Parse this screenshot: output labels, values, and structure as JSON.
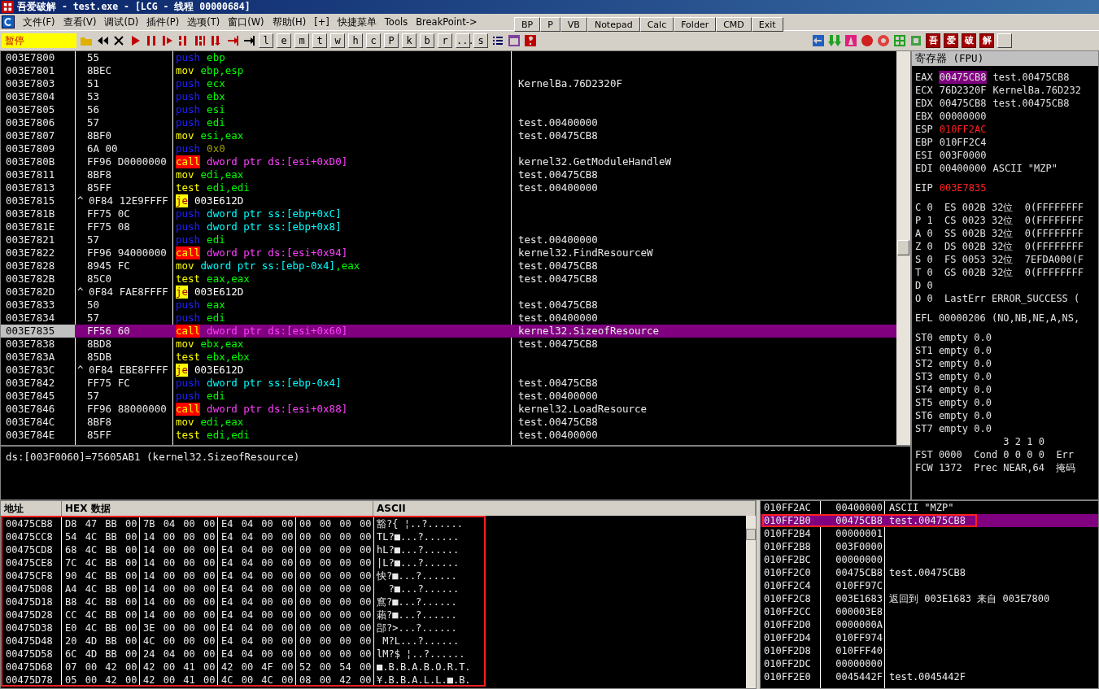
{
  "window": {
    "title": "吾爱破解 - test.exe - [LCG - 线程 00000684]"
  },
  "menu": [
    "文件(F)",
    "查看(V)",
    "调试(D)",
    "插件(P)",
    "选项(T)",
    "窗口(W)",
    "帮助(H)",
    "[+]",
    "快捷菜单",
    "Tools",
    "BreakPoint->"
  ],
  "quick_buttons": [
    "BP",
    "P",
    "VB",
    "Notepad",
    "Calc",
    "Folder",
    "CMD",
    "Exit"
  ],
  "toolbar": {
    "status": "暂停",
    "letters": [
      "l",
      "e",
      "m",
      "t",
      "w",
      "h",
      "c",
      "P",
      "k",
      "b",
      "r",
      "...",
      "s"
    ],
    "brand_buttons": [
      "吾",
      "爱",
      "破",
      "解"
    ]
  },
  "disassembly": {
    "rows": [
      {
        "address": "003E7800",
        "hex": "55",
        "mnemonic": "push",
        "kind": "push",
        "operands": [
          {
            "text": "ebp",
            "kind": "reg"
          }
        ],
        "selected": false
      },
      {
        "address": "003E7801",
        "hex": "8BEC",
        "mnemonic": "mov",
        "kind": "plain",
        "operands": [
          {
            "text": "ebp,esp",
            "kind": "reg"
          }
        ],
        "selected": false
      },
      {
        "address": "003E7803",
        "hex": "51",
        "mnemonic": "push",
        "kind": "push",
        "operands": [
          {
            "text": "ecx",
            "kind": "reg"
          }
        ],
        "comment": "KernelBa.76D2320F",
        "selected": false
      },
      {
        "address": "003E7804",
        "hex": "53",
        "mnemonic": "push",
        "kind": "push",
        "operands": [
          {
            "text": "ebx",
            "kind": "reg"
          }
        ],
        "selected": false
      },
      {
        "address": "003E7805",
        "hex": "56",
        "mnemonic": "push",
        "kind": "push",
        "operands": [
          {
            "text": "esi",
            "kind": "reg"
          }
        ],
        "selected": false
      },
      {
        "address": "003E7806",
        "hex": "57",
        "mnemonic": "push",
        "kind": "push",
        "operands": [
          {
            "text": "edi",
            "kind": "reg"
          }
        ],
        "comment": "test.00400000",
        "selected": false
      },
      {
        "address": "003E7807",
        "hex": "8BF0",
        "mnemonic": "mov",
        "kind": "plain",
        "operands": [
          {
            "text": "esi,eax",
            "kind": "reg"
          }
        ],
        "comment": "test.00475CB8",
        "selected": false
      },
      {
        "address": "003E7809",
        "hex": "6A 00",
        "mnemonic": "push",
        "kind": "push",
        "operands": [
          {
            "text": "0x0",
            "kind": "imm"
          }
        ],
        "selected": false
      },
      {
        "address": "003E780B",
        "hex": "FF96 D0000000",
        "mnemonic": "call",
        "kind": "call",
        "operands": [
          {
            "text": "dword ptr ds:[esi+0xD0]",
            "kind": "mem"
          }
        ],
        "comment": "kernel32.GetModuleHandleW",
        "selected": false
      },
      {
        "address": "003E7811",
        "hex": "8BF8",
        "mnemonic": "mov",
        "kind": "plain",
        "operands": [
          {
            "text": "edi,eax",
            "kind": "reg"
          }
        ],
        "comment": "test.00475CB8",
        "selected": false
      },
      {
        "address": "003E7813",
        "hex": "85FF",
        "mnemonic": "test",
        "kind": "plain",
        "operands": [
          {
            "text": "edi,edi",
            "kind": "reg"
          }
        ],
        "comment": "test.00400000",
        "selected": false
      },
      {
        "address": "003E7815",
        "jump_mark": "^",
        "hex": "0F84 12E9FFFF",
        "mnemonic": "je",
        "kind": "jump",
        "operands": [
          {
            "text": "003E612D",
            "kind": "addr"
          }
        ],
        "selected": false
      },
      {
        "address": "003E781B",
        "hex": "FF75 0C",
        "mnemonic": "push",
        "kind": "push",
        "operands": [
          {
            "text": "dword ptr ss:[ebp+0xC]",
            "kind": "stack"
          }
        ],
        "selected": false
      },
      {
        "address": "003E781E",
        "hex": "FF75 08",
        "mnemonic": "push",
        "kind": "push",
        "operands": [
          {
            "text": "dword ptr ss:[ebp+0x8]",
            "kind": "stack"
          }
        ],
        "selected": false
      },
      {
        "address": "003E7821",
        "hex": "57",
        "mnemonic": "push",
        "kind": "push",
        "operands": [
          {
            "text": "edi",
            "kind": "reg"
          }
        ],
        "comment": "test.00400000",
        "selected": false
      },
      {
        "address": "003E7822",
        "hex": "FF96 94000000",
        "mnemonic": "call",
        "kind": "call",
        "operands": [
          {
            "text": "dword ptr ds:[esi+0x94]",
            "kind": "mem"
          }
        ],
        "comment": "kernel32.FindResourceW",
        "selected": false
      },
      {
        "address": "003E7828",
        "hex": "8945 FC",
        "mnemonic": "mov",
        "kind": "plain",
        "operands": [
          {
            "text": "dword ptr ss:[ebp-0x4]",
            "kind": "stack"
          },
          {
            "text": ",eax",
            "kind": "reg"
          }
        ],
        "comment": "test.00475CB8",
        "selected": false
      },
      {
        "address": "003E782B",
        "hex": "85C0",
        "mnemonic": "test",
        "kind": "plain",
        "operands": [
          {
            "text": "eax,eax",
            "kind": "reg"
          }
        ],
        "comment": "test.00475CB8",
        "selected": false
      },
      {
        "address": "003E782D",
        "jump_mark": "^",
        "hex": "0F84 FAE8FFFF",
        "mnemonic": "je",
        "kind": "jump",
        "operands": [
          {
            "text": "003E612D",
            "kind": "addr"
          }
        ],
        "selected": false
      },
      {
        "address": "003E7833",
        "hex": "50",
        "mnemonic": "push",
        "kind": "push",
        "operands": [
          {
            "text": "eax",
            "kind": "reg"
          }
        ],
        "comment": "test.00475CB8",
        "selected": false
      },
      {
        "address": "003E7834",
        "hex": "57",
        "mnemonic": "push",
        "kind": "push",
        "operands": [
          {
            "text": "edi",
            "kind": "reg"
          }
        ],
        "comment": "test.00400000",
        "selected": false
      },
      {
        "address": "003E7835",
        "hex": "FF56 60",
        "mnemonic": "call",
        "kind": "call",
        "operands": [
          {
            "text": "dword ptr ds:[esi+0x60]",
            "kind": "mem"
          }
        ],
        "comment": "kernel32.SizeofResource",
        "selected": true
      },
      {
        "address": "003E7838",
        "hex": "8BD8",
        "mnemonic": "mov",
        "kind": "plain",
        "operands": [
          {
            "text": "ebx,eax",
            "kind": "reg"
          }
        ],
        "comment": "test.00475CB8",
        "selected": false
      },
      {
        "address": "003E783A",
        "hex": "85DB",
        "mnemonic": "test",
        "kind": "plain",
        "operands": [
          {
            "text": "ebx,ebx",
            "kind": "reg"
          }
        ],
        "selected": false
      },
      {
        "address": "003E783C",
        "jump_mark": "^",
        "hex": "0F84 EBE8FFFF",
        "mnemonic": "je",
        "kind": "jump",
        "operands": [
          {
            "text": "003E612D",
            "kind": "addr"
          }
        ],
        "selected": false
      },
      {
        "address": "003E7842",
        "hex": "FF75 FC",
        "mnemonic": "push",
        "kind": "push",
        "operands": [
          {
            "text": "dword ptr ss:[ebp-0x4]",
            "kind": "stack"
          }
        ],
        "comment": "test.00475CB8",
        "selected": false
      },
      {
        "address": "003E7845",
        "hex": "57",
        "mnemonic": "push",
        "kind": "push",
        "operands": [
          {
            "text": "edi",
            "kind": "reg"
          }
        ],
        "comment": "test.00400000",
        "selected": false
      },
      {
        "address": "003E7846",
        "hex": "FF96 88000000",
        "mnemonic": "call",
        "kind": "call",
        "operands": [
          {
            "text": "dword ptr ds:[esi+0x88]",
            "kind": "mem"
          }
        ],
        "comment": "kernel32.LoadResource",
        "selected": false
      },
      {
        "address": "003E784C",
        "hex": "8BF8",
        "mnemonic": "mov",
        "kind": "plain",
        "operands": [
          {
            "text": "edi,eax",
            "kind": "reg"
          }
        ],
        "comment": "test.00475CB8",
        "selected": false
      },
      {
        "address": "003E784E",
        "hex": "85FF",
        "mnemonic": "test",
        "kind": "plain",
        "operands": [
          {
            "text": "edi,edi",
            "kind": "reg"
          }
        ],
        "comment": "test.00400000",
        "selected": false
      }
    ],
    "info": "ds:[003F0060]=75605AB1 (kernel32.SizeofResource)"
  },
  "registers": {
    "title": "寄存器 (FPU)",
    "groups": [
      [
        {
          "kind": "reg",
          "name": "EAX",
          "value": "00475CB8",
          "comment": "test.00475CB8",
          "changed": false,
          "selected": true
        },
        {
          "kind": "reg",
          "name": "ECX",
          "value": "76D2320F",
          "comment": "KernelBa.76D232",
          "changed": false,
          "selected": false
        },
        {
          "kind": "reg",
          "name": "EDX",
          "value": "00475CB8",
          "comment": "test.00475CB8",
          "changed": false,
          "selected": false
        },
        {
          "kind": "reg",
          "name": "EBX",
          "value": "00000000",
          "changed": false,
          "selected": false
        },
        {
          "kind": "reg",
          "name": "ESP",
          "value": "010FF2AC",
          "changed": true,
          "selected": false
        },
        {
          "kind": "reg",
          "name": "EBP",
          "value": "010FF2C4",
          "changed": false,
          "selected": false
        },
        {
          "kind": "reg",
          "name": "ESI",
          "value": "003F0000",
          "changed": false,
          "selected": false
        },
        {
          "kind": "reg",
          "name": "EDI",
          "value": "00400000",
          "comment": "ASCII \"MZP\"",
          "changed": false,
          "selected": false
        }
      ],
      [
        {
          "kind": "reg",
          "name": "EIP",
          "value": "003E7835",
          "changed": true,
          "selected": false
        }
      ],
      [
        {
          "kind": "text",
          "text": "C 0  ES 002B 32位  0(FFFFFFFF"
        },
        {
          "kind": "text",
          "text": "P 1  CS 0023 32位  0(FFFFFFFF"
        },
        {
          "kind": "text",
          "text": "A 0  SS 002B 32位  0(FFFFFFFF"
        },
        {
          "kind": "text",
          "text": "Z 0  DS 002B 32位  0(FFFFFFFF"
        },
        {
          "kind": "text",
          "text": "S 0  FS 0053 32位  7EFDA000(F"
        },
        {
          "kind": "text",
          "text": "T 0  GS 002B 32位  0(FFFFFFFF"
        },
        {
          "kind": "text",
          "text": "D 0"
        },
        {
          "kind": "text",
          "text": "O 0  LastErr ERROR_SUCCESS ("
        }
      ],
      [
        {
          "kind": "text",
          "text": "EFL 00000206 (NO,NB,NE,A,NS,"
        }
      ],
      [
        {
          "kind": "text",
          "text": "ST0 empty 0.0"
        },
        {
          "kind": "text",
          "text": "ST1 empty 0.0"
        },
        {
          "kind": "text",
          "text": "ST2 empty 0.0"
        },
        {
          "kind": "text",
          "text": "ST3 empty 0.0"
        },
        {
          "kind": "text",
          "text": "ST4 empty 0.0"
        },
        {
          "kind": "text",
          "text": "ST5 empty 0.0"
        },
        {
          "kind": "text",
          "text": "ST6 empty 0.0"
        },
        {
          "kind": "text",
          "text": "ST7 empty 0.0"
        },
        {
          "kind": "text",
          "text": "               3 2 1 0"
        },
        {
          "kind": "text",
          "text": "FST 0000  Cond 0 0 0 0  Err"
        },
        {
          "kind": "text",
          "text": "FCW 1372  Prec NEAR,64  掩码"
        }
      ]
    ]
  },
  "dump": {
    "columns": [
      "地址",
      "HEX 数据",
      "ASCII"
    ],
    "annotated": true,
    "rows": [
      {
        "address": "00475CB8",
        "hex": [
          "D8 47 BB 00",
          "7B 04 00 00",
          "E4 04 00 00",
          "00 00 00 00"
        ],
        "ascii": "豁?{ ¦..?......"
      },
      {
        "address": "00475CC8",
        "hex": [
          "54 4C BB 00",
          "14 00 00 00",
          "E4 04 00 00",
          "00 00 00 00"
        ],
        "ascii": "TL?■...?......"
      },
      {
        "address": "00475CD8",
        "hex": [
          "68 4C BB 00",
          "14 00 00 00",
          "E4 04 00 00",
          "00 00 00 00"
        ],
        "ascii": "hL?■...?......"
      },
      {
        "address": "00475CE8",
        "hex": [
          "7C 4C BB 00",
          "14 00 00 00",
          "E4 04 00 00",
          "00 00 00 00"
        ],
        "ascii": "|L?■...?......"
      },
      {
        "address": "00475CF8",
        "hex": [
          "90 4C BB 00",
          "14 00 00 00",
          "E4 04 00 00",
          "00 00 00 00"
        ],
        "ascii": "怏?■...?......"
      },
      {
        "address": "00475D08",
        "hex": [
          "A4 4C BB 00",
          "14 00 00 00",
          "E4 04 00 00",
          "00 00 00 00"
        ],
        "ascii": "  ?■...?......"
      },
      {
        "address": "00475D18",
        "hex": [
          "B8 4C BB 00",
          "14 00 00 00",
          "E4 04 00 00",
          "00 00 00 00"
        ],
        "ascii": "窵?■...?......"
      },
      {
        "address": "00475D28",
        "hex": [
          "CC 4C BB 00",
          "14 00 00 00",
          "E4 04 00 00",
          "00 00 00 00"
        ],
        "ascii": "藾?■...?......"
      },
      {
        "address": "00475D38",
        "hex": [
          "E0 4C BB 00",
          "3E 00 00 00",
          "E4 04 00 00",
          "00 00 00 00"
        ],
        "ascii": "郘?>...?......"
      },
      {
        "address": "00475D48",
        "hex": [
          "20 4D BB 00",
          "4C 00 00 00",
          "E4 04 00 00",
          "00 00 00 00"
        ],
        "ascii": " M?L...?......"
      },
      {
        "address": "00475D58",
        "hex": [
          "6C 4D BB 00",
          "24 04 00 00",
          "E4 04 00 00",
          "00 00 00 00"
        ],
        "ascii": "lM?$ ¦..?......"
      },
      {
        "address": "00475D68",
        "hex": [
          "07 00 42 00",
          "42 00 41 00",
          "42 00 4F 00",
          "52 00 54 00"
        ],
        "ascii": "■.B.B.A.B.O.R.T."
      },
      {
        "address": "00475D78",
        "hex": [
          "05 00 42 00",
          "42 00 41 00",
          "4C 00 4C 00",
          "08 00 42 00"
        ],
        "ascii": "¥.B.B.A.L.L.■.B."
      }
    ]
  },
  "stack": {
    "rows": [
      {
        "address": "010FF2AC",
        "value": "00400000",
        "comment": "ASCII \"MZP\"",
        "selected": false,
        "annotated": false
      },
      {
        "address": "010FF2B0",
        "value": "00475CB8",
        "comment": "test.00475CB8",
        "selected": true,
        "annotated": true
      },
      {
        "address": "010FF2B4",
        "value": "00000001",
        "selected": false,
        "annotated": false
      },
      {
        "address": "010FF2B8",
        "value": "003F0000",
        "selected": false,
        "annotated": false
      },
      {
        "address": "010FF2BC",
        "value": "00000000",
        "selected": false,
        "annotated": false
      },
      {
        "address": "010FF2C0",
        "value": "00475CB8",
        "comment": "test.00475CB8",
        "selected": false,
        "annotated": false
      },
      {
        "address": "010FF2C4",
        "value": "010FF97C",
        "selected": false,
        "annotated": false
      },
      {
        "address": "010FF2C8",
        "value": "003E1683",
        "comment": "返回到 003E1683 来自 003E7800",
        "selected": false,
        "annotated": false
      },
      {
        "address": "010FF2CC",
        "value": "000003E8",
        "selected": false,
        "annotated": false
      },
      {
        "address": "010FF2D0",
        "value": "0000000A",
        "selected": false,
        "annotated": false
      },
      {
        "address": "010FF2D4",
        "value": "010FF974",
        "selected": false,
        "annotated": false
      },
      {
        "address": "010FF2D8",
        "value": "010FFF40",
        "selected": false,
        "annotated": false
      },
      {
        "address": "010FF2DC",
        "value": "00000000",
        "selected": false,
        "annotated": false
      },
      {
        "address": "010FF2E0",
        "value": "0045442F",
        "comment": "test.0045442F",
        "selected": false,
        "annotated": false
      }
    ]
  }
}
